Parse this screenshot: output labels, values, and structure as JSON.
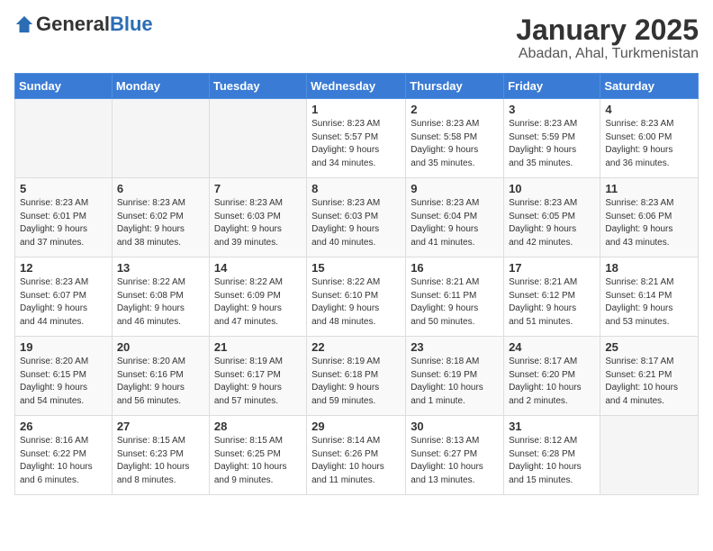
{
  "logo": {
    "general": "General",
    "blue": "Blue"
  },
  "title": "January 2025",
  "subtitle": "Abadan, Ahal, Turkmenistan",
  "days_of_week": [
    "Sunday",
    "Monday",
    "Tuesday",
    "Wednesday",
    "Thursday",
    "Friday",
    "Saturday"
  ],
  "weeks": [
    [
      {
        "day": "",
        "info": ""
      },
      {
        "day": "",
        "info": ""
      },
      {
        "day": "",
        "info": ""
      },
      {
        "day": "1",
        "info": "Sunrise: 8:23 AM\nSunset: 5:57 PM\nDaylight: 9 hours\nand 34 minutes."
      },
      {
        "day": "2",
        "info": "Sunrise: 8:23 AM\nSunset: 5:58 PM\nDaylight: 9 hours\nand 35 minutes."
      },
      {
        "day": "3",
        "info": "Sunrise: 8:23 AM\nSunset: 5:59 PM\nDaylight: 9 hours\nand 35 minutes."
      },
      {
        "day": "4",
        "info": "Sunrise: 8:23 AM\nSunset: 6:00 PM\nDaylight: 9 hours\nand 36 minutes."
      }
    ],
    [
      {
        "day": "5",
        "info": "Sunrise: 8:23 AM\nSunset: 6:01 PM\nDaylight: 9 hours\nand 37 minutes."
      },
      {
        "day": "6",
        "info": "Sunrise: 8:23 AM\nSunset: 6:02 PM\nDaylight: 9 hours\nand 38 minutes."
      },
      {
        "day": "7",
        "info": "Sunrise: 8:23 AM\nSunset: 6:03 PM\nDaylight: 9 hours\nand 39 minutes."
      },
      {
        "day": "8",
        "info": "Sunrise: 8:23 AM\nSunset: 6:03 PM\nDaylight: 9 hours\nand 40 minutes."
      },
      {
        "day": "9",
        "info": "Sunrise: 8:23 AM\nSunset: 6:04 PM\nDaylight: 9 hours\nand 41 minutes."
      },
      {
        "day": "10",
        "info": "Sunrise: 8:23 AM\nSunset: 6:05 PM\nDaylight: 9 hours\nand 42 minutes."
      },
      {
        "day": "11",
        "info": "Sunrise: 8:23 AM\nSunset: 6:06 PM\nDaylight: 9 hours\nand 43 minutes."
      }
    ],
    [
      {
        "day": "12",
        "info": "Sunrise: 8:23 AM\nSunset: 6:07 PM\nDaylight: 9 hours\nand 44 minutes."
      },
      {
        "day": "13",
        "info": "Sunrise: 8:22 AM\nSunset: 6:08 PM\nDaylight: 9 hours\nand 46 minutes."
      },
      {
        "day": "14",
        "info": "Sunrise: 8:22 AM\nSunset: 6:09 PM\nDaylight: 9 hours\nand 47 minutes."
      },
      {
        "day": "15",
        "info": "Sunrise: 8:22 AM\nSunset: 6:10 PM\nDaylight: 9 hours\nand 48 minutes."
      },
      {
        "day": "16",
        "info": "Sunrise: 8:21 AM\nSunset: 6:11 PM\nDaylight: 9 hours\nand 50 minutes."
      },
      {
        "day": "17",
        "info": "Sunrise: 8:21 AM\nSunset: 6:12 PM\nDaylight: 9 hours\nand 51 minutes."
      },
      {
        "day": "18",
        "info": "Sunrise: 8:21 AM\nSunset: 6:14 PM\nDaylight: 9 hours\nand 53 minutes."
      }
    ],
    [
      {
        "day": "19",
        "info": "Sunrise: 8:20 AM\nSunset: 6:15 PM\nDaylight: 9 hours\nand 54 minutes."
      },
      {
        "day": "20",
        "info": "Sunrise: 8:20 AM\nSunset: 6:16 PM\nDaylight: 9 hours\nand 56 minutes."
      },
      {
        "day": "21",
        "info": "Sunrise: 8:19 AM\nSunset: 6:17 PM\nDaylight: 9 hours\nand 57 minutes."
      },
      {
        "day": "22",
        "info": "Sunrise: 8:19 AM\nSunset: 6:18 PM\nDaylight: 9 hours\nand 59 minutes."
      },
      {
        "day": "23",
        "info": "Sunrise: 8:18 AM\nSunset: 6:19 PM\nDaylight: 10 hours\nand 1 minute."
      },
      {
        "day": "24",
        "info": "Sunrise: 8:17 AM\nSunset: 6:20 PM\nDaylight: 10 hours\nand 2 minutes."
      },
      {
        "day": "25",
        "info": "Sunrise: 8:17 AM\nSunset: 6:21 PM\nDaylight: 10 hours\nand 4 minutes."
      }
    ],
    [
      {
        "day": "26",
        "info": "Sunrise: 8:16 AM\nSunset: 6:22 PM\nDaylight: 10 hours\nand 6 minutes."
      },
      {
        "day": "27",
        "info": "Sunrise: 8:15 AM\nSunset: 6:23 PM\nDaylight: 10 hours\nand 8 minutes."
      },
      {
        "day": "28",
        "info": "Sunrise: 8:15 AM\nSunset: 6:25 PM\nDaylight: 10 hours\nand 9 minutes."
      },
      {
        "day": "29",
        "info": "Sunrise: 8:14 AM\nSunset: 6:26 PM\nDaylight: 10 hours\nand 11 minutes."
      },
      {
        "day": "30",
        "info": "Sunrise: 8:13 AM\nSunset: 6:27 PM\nDaylight: 10 hours\nand 13 minutes."
      },
      {
        "day": "31",
        "info": "Sunrise: 8:12 AM\nSunset: 6:28 PM\nDaylight: 10 hours\nand 15 minutes."
      },
      {
        "day": "",
        "info": ""
      }
    ]
  ]
}
